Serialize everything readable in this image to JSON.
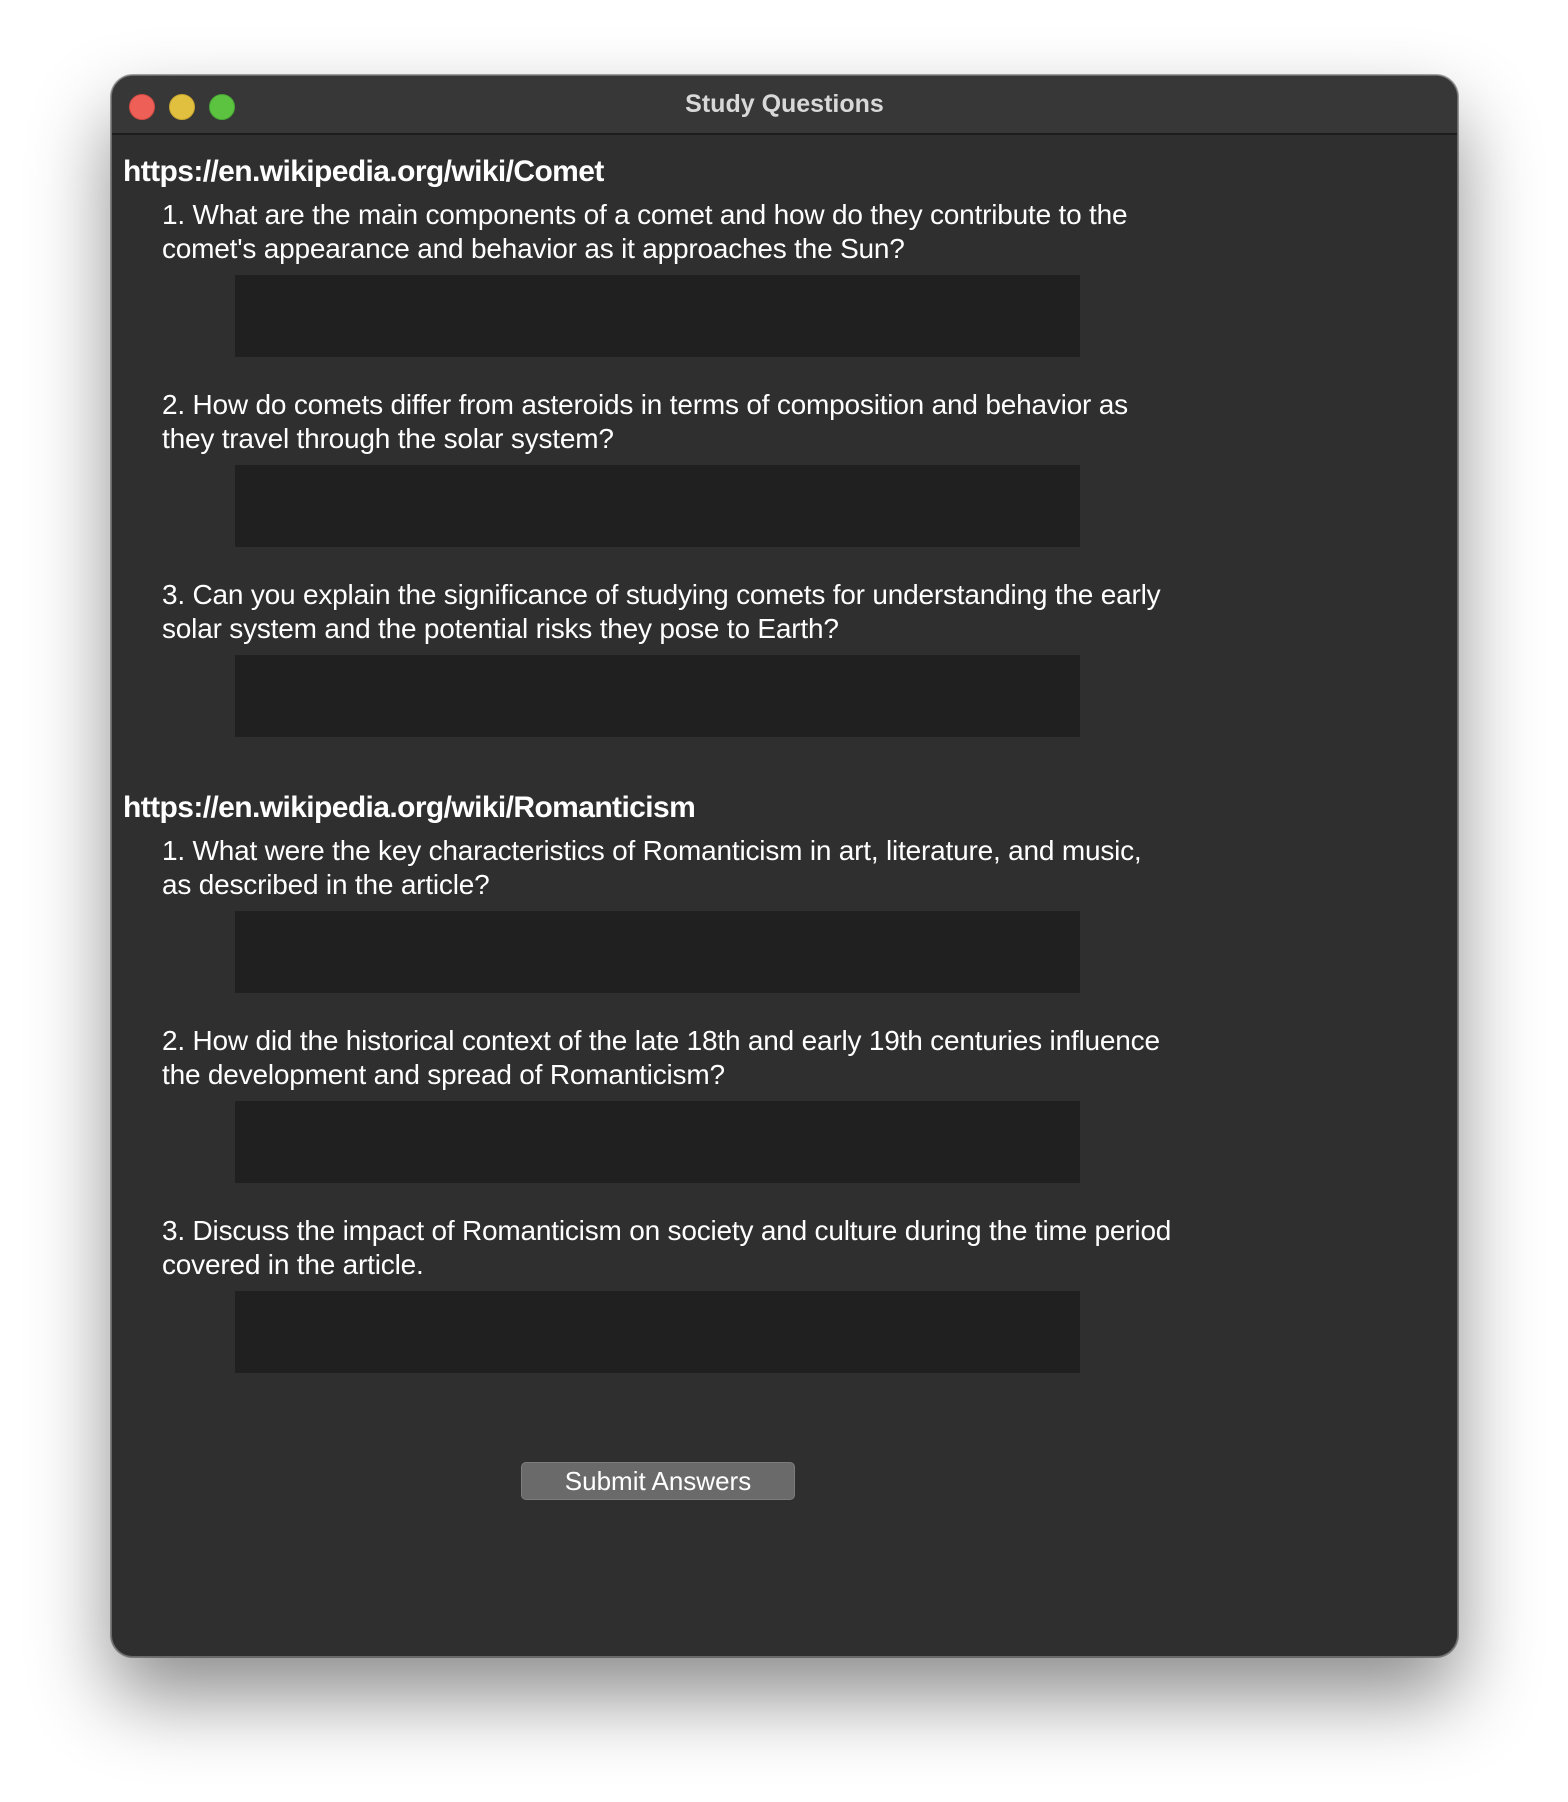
{
  "window": {
    "title": "Study Questions"
  },
  "sections": [
    {
      "url": "https://en.wikipedia.org/wiki/Comet",
      "questions": [
        {
          "text": "1. What are the main components of a comet and how do they contribute to the comet's appearance and behavior as it approaches the Sun?",
          "answer": ""
        },
        {
          "text": "2. How do comets differ from asteroids in terms of composition and behavior as they travel through the solar system?",
          "answer": ""
        },
        {
          "text": "3. Can you explain the significance of studying comets for understanding the early solar system and the potential risks they pose to Earth?",
          "answer": ""
        }
      ]
    },
    {
      "url": "https://en.wikipedia.org/wiki/Romanticism",
      "questions": [
        {
          "text": "1. What were the key characteristics of Romanticism in art, literature, and music, as described in the article?",
          "answer": ""
        },
        {
          "text": "2. How did the historical context of the late 18th and early 19th centuries influence the development and spread of Romanticism?",
          "answer": ""
        },
        {
          "text": "3. Discuss the impact of Romanticism on society and culture during the time period covered in the article.",
          "answer": ""
        }
      ]
    }
  ],
  "submit_label": "Submit Answers",
  "colors": {
    "window_bg": "#2f2f2f",
    "answer_bg": "#202020",
    "button_bg": "#6a6a6a",
    "close": "#ee5f57",
    "minimize": "#e1c03f",
    "zoom": "#5cc341"
  }
}
